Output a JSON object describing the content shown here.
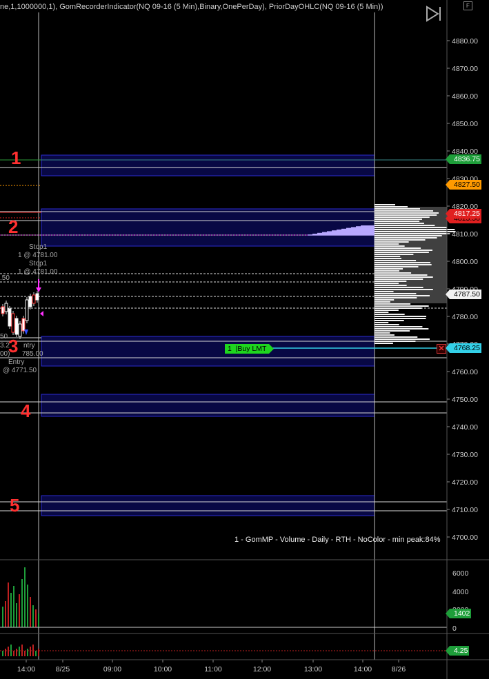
{
  "header": {
    "title": "ne,1,1000000,1), GomRecorderIndicator(NQ 09-16 (5 Min),Binary,OnePerDay), PriorDayOHLC(NQ 09-16 (5 Min))",
    "control_button": "F"
  },
  "price_axis": {
    "ticks": [
      "4880.00",
      "4870.00",
      "4860.00",
      "4850.00",
      "4840.00",
      "4830.00",
      "4820.00",
      "4810.00",
      "4800.00",
      "4790.00",
      "4780.00",
      "4770.00",
      "4760.00",
      "4750.00",
      "4740.00",
      "4730.00",
      "4720.00",
      "4710.00",
      "4700.00"
    ]
  },
  "price_tags": [
    {
      "label": "4836.75",
      "color": "#1e9e3a"
    },
    {
      "label": "4827.50",
      "color": "#ff9a00"
    },
    {
      "label": "4817.25",
      "color": "#e02020"
    },
    {
      "label": "4815.50",
      "color": "#e02020"
    },
    {
      "label": "4787.50",
      "color": "#f2f2f2"
    },
    {
      "label": "4768.25",
      "color": "#33d0e8"
    }
  ],
  "zones": [
    {
      "label": "1"
    },
    {
      "label": "2"
    },
    {
      "label": "3"
    },
    {
      "label": "4"
    },
    {
      "label": "5"
    }
  ],
  "order": {
    "qty": "1",
    "type": "Buy LMT"
  },
  "annotations": {
    "stop1_a": "Stop1",
    "stop1_a_price": "1 @ 4781.00",
    "stop1_b": "Stop1",
    "stop1_b_price": "1 @ 4781.00",
    "left_cut": ".50",
    "entry_cut_a": "3.2",
    "entry_cut_b": "ntry",
    "entry_cut_c": "50",
    "entry_cut_d": "00)",
    "entry_cut_e": "785.00",
    "entry": "Entry",
    "entry_price": "@ 4771.50"
  },
  "profile_caption": "1 - GomMP  - Volume - Daily - RTH - NoColor - min peak:84%",
  "volume_axis": {
    "ticks": [
      "6000",
      "4000",
      "2000",
      "0"
    ],
    "last": "1402"
  },
  "indicator_axis": {
    "last": "4.25"
  },
  "time_axis": {
    "ticks": [
      "14:00",
      "8/25",
      "09:00",
      "10:00",
      "11:00",
      "12:00",
      "13:00",
      "14:00",
      "8/26"
    ]
  }
}
